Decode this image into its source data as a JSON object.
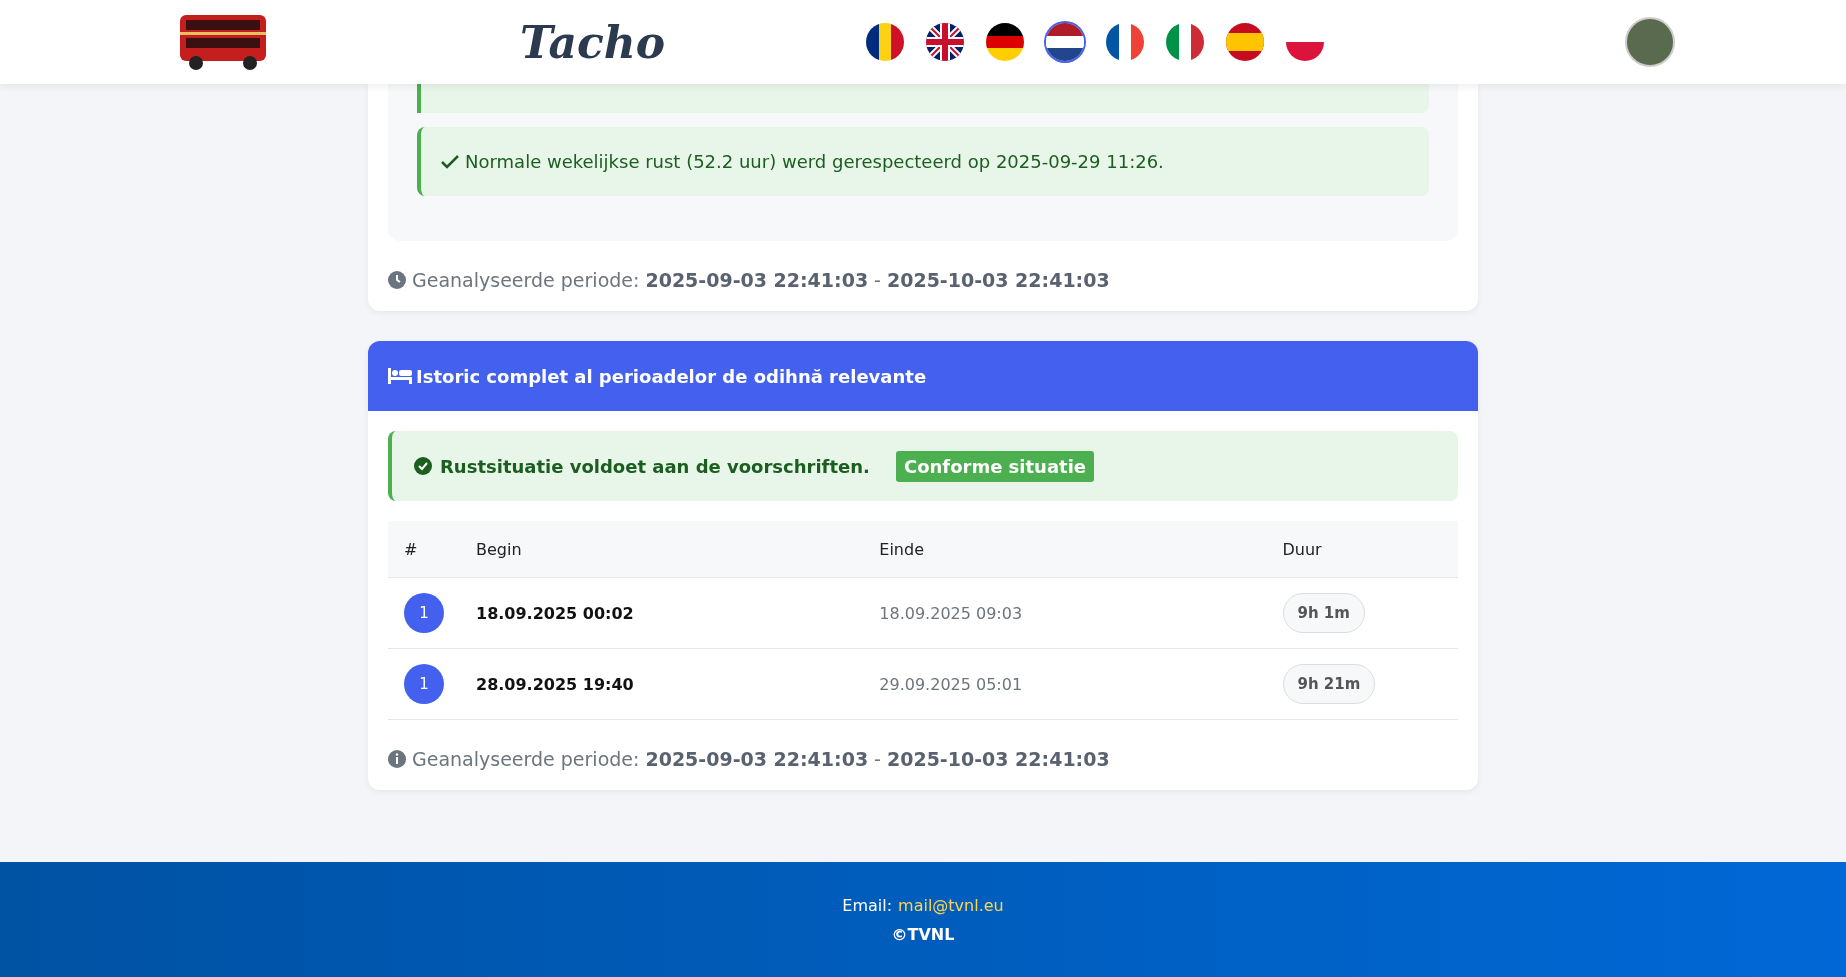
{
  "header": {
    "title": "Tacho",
    "flags": [
      {
        "kind": "romania",
        "selected": false
      },
      {
        "kind": "uk",
        "selected": false
      },
      {
        "kind": "germany",
        "selected": false
      },
      {
        "kind": "netherlands",
        "selected": true
      },
      {
        "kind": "france",
        "selected": false
      },
      {
        "kind": "italy",
        "selected": false
      },
      {
        "kind": "spain",
        "selected": false
      },
      {
        "kind": "poland",
        "selected": false
      }
    ]
  },
  "weekly_card": {
    "alerts": [
      {
        "kind": "cut"
      },
      {
        "kind": "full",
        "text": "Normale wekelijkse rust (52.2 uur) werd gerespecteerd op 2025-09-29 11:26."
      }
    ],
    "period": {
      "label": "Geanalyseerde periode:",
      "start": "2025-09-03 22:41:03",
      "separator": "-",
      "end": "2025-10-03 22:41:03"
    }
  },
  "rest_card": {
    "title": "Istoric complet al perioadelor de odihnă relevante",
    "status": {
      "text": "Rustsituatie voldoet aan de voorschriften.",
      "badge": "Conforme situatie"
    },
    "table": {
      "columns": [
        "#",
        "Begin",
        "Einde",
        "Duur"
      ],
      "rows": [
        {
          "number": "1",
          "begin": "18.09.2025 00:02",
          "end": "18.09.2025 09:03",
          "duration": "9h 1m"
        },
        {
          "number": "1",
          "begin": "28.09.2025 19:40",
          "end": "29.09.2025 05:01",
          "duration": "9h 21m"
        }
      ]
    },
    "period": {
      "label": "Geanalyseerde periode:",
      "start": "2025-09-03 22:41:03",
      "separator": "-",
      "end": "2025-10-03 22:41:03"
    }
  },
  "footer": {
    "email_label": "Email:",
    "email": "mail@tvnl.eu",
    "copyright": "©TVNL"
  }
}
